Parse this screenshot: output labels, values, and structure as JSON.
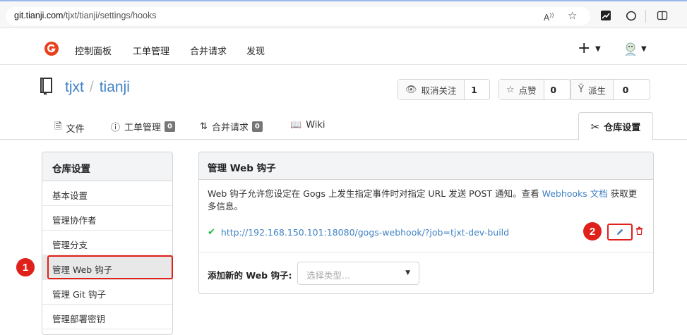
{
  "browser": {
    "url_host": "git.tianji.com",
    "url_path": "/tjxt/tianji/settings/hooks",
    "icons": [
      "read-aloud-icon",
      "favorite-star-icon",
      "extension-icon",
      "copilot-icon",
      "split-screen-icon"
    ]
  },
  "nav": {
    "items": [
      "控制面板",
      "工单管理",
      "合并请求",
      "发现"
    ],
    "plus": "+"
  },
  "repo": {
    "owner": "tjxt",
    "separator": "/",
    "name": "tianji",
    "watch": {
      "label": "取消关注",
      "count": "1"
    },
    "star": {
      "label": "点赞",
      "count": "0"
    },
    "fork": {
      "label": "派生",
      "count": "0"
    }
  },
  "tabs": [
    {
      "label": "文件"
    },
    {
      "label": "工单管理",
      "badge": "0"
    },
    {
      "label": "合并请求",
      "badge": "0"
    },
    {
      "label": "Wiki"
    }
  ],
  "active_tab": "仓库设置",
  "sidebar": {
    "header": "仓库设置",
    "items": [
      "基本设置",
      "管理协作者",
      "管理分支",
      "管理 Web 钩子",
      "管理 Git 钩子",
      "管理部署密钥"
    ]
  },
  "panel": {
    "title": "管理 Web 钩子",
    "desc_before": "Web 钩子允许您设定在 Gogs 上发生指定事件时对指定 URL 发送 POST 通知。查看 ",
    "desc_link": "Webhooks 文档",
    "desc_after": " 获取更多信息。",
    "hook_url": "http://192.168.150.101:18080/gogs-webhook/?job=tjxt-dev-build",
    "add_label": "添加新的 Web 钩子:",
    "select_placeholder": "选择类型..."
  },
  "markers": {
    "one": "1",
    "two": "2"
  },
  "colors": {
    "link": "#4183c4",
    "highlight": "#e0201a",
    "success": "#21ba45",
    "danger": "#db2828"
  }
}
